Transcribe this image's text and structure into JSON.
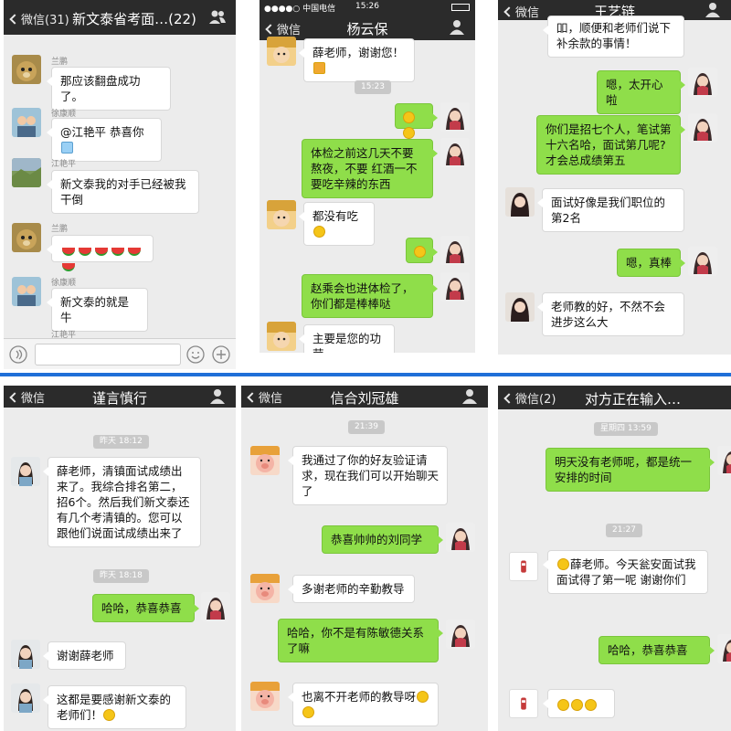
{
  "panels": {
    "p1": {
      "back": "微信(31)",
      "title": "新文泰省考面…(22)",
      "messages": [
        {
          "name": "兰鹏",
          "text": "那应该翻盘成功了。"
        },
        {
          "name": "徐康顺",
          "text": "@江艳平 恭喜你"
        },
        {
          "name": "江艳平",
          "text": "新文泰我的对手已经被我干倒"
        },
        {
          "name": "兰鹏",
          "text": ""
        },
        {
          "name": "徐康顺",
          "text": "新文泰的就是牛"
        },
        {
          "name": "江艳平",
          "text": ""
        }
      ]
    },
    "p2": {
      "carrier": "●●●●○ 中国电信",
      "clock": "15:26",
      "back": "微信",
      "title": "杨云保",
      "time1": "15:23",
      "messages": [
        {
          "text": "薛老师，谢谢您！"
        },
        {
          "text": ""
        },
        {
          "text": "体检之前这几天不要熬夜，不要 红酒一不要吃辛辣的东西"
        },
        {
          "text": "都没有吃"
        },
        {
          "text": ""
        },
        {
          "text": "赵乘会也进体检了，你们都是棒棒哒"
        },
        {
          "text": "主要是您的功劳"
        }
      ]
    },
    "p3": {
      "back": "微信",
      "title": "王艺链",
      "messages": [
        {
          "text": "吅，顺便和老师们说下补余款的事情！"
        },
        {
          "text": "嗯，太开心啦"
        },
        {
          "text": "你们是招七个人，笔试第十六名哈，面试第几呢?才会总成绩第五"
        },
        {
          "text": "面试好像是我们职位的第2名"
        },
        {
          "text": "嗯，真棒"
        },
        {
          "text": "老师教的好，不然不会进步这么大"
        }
      ]
    },
    "p4": {
      "back": "微信",
      "title": "谨言慎行",
      "time1": "昨天 18:12",
      "time2": "昨天 18:18",
      "messages": [
        {
          "text": "薛老师，清镇面试成绩出来了。我综合排名第二，招6个。然后我们新文泰还有几个考清镇的。您可以跟他们说面试成绩出来了"
        },
        {
          "text": "哈哈，恭喜恭喜"
        },
        {
          "text": "谢谢薛老师"
        },
        {
          "text": "这都是要感谢新文泰的老师们！"
        }
      ]
    },
    "p5": {
      "back": "微信",
      "title": "信合刘冠雄",
      "time1": "21:39",
      "messages": [
        {
          "text": "我通过了你的好友验证请求，现在我们可以开始聊天了"
        },
        {
          "text": "恭喜帅帅的刘同学"
        },
        {
          "text": "多谢老师的辛勤教导"
        },
        {
          "text": "哈哈，你不是有陈敏德关系了嘛"
        },
        {
          "text": "也离不开老师的教导呀"
        }
      ]
    },
    "p6": {
      "back": "微信(2)",
      "title": "对方正在输入…",
      "time1": "星期四 13:59",
      "time2": "21:27",
      "messages": [
        {
          "text": "明天没有老师呢，都是统一安排的时间"
        },
        {
          "text": "薛老师。今天瓮安面试我面试得了第一呢 谢谢你们"
        },
        {
          "text": "哈哈，恭喜恭喜"
        },
        {
          "text": ""
        }
      ]
    }
  },
  "colors": {
    "header": "#2b2b2b",
    "chat_bg": "#ececec",
    "green_bubble": "#8fde4a",
    "divider": "#1f6fd8"
  },
  "icons": [
    "back-chevron-icon",
    "person-icon",
    "group-icon",
    "voice-icon",
    "emoji-icon",
    "plus-icon"
  ]
}
